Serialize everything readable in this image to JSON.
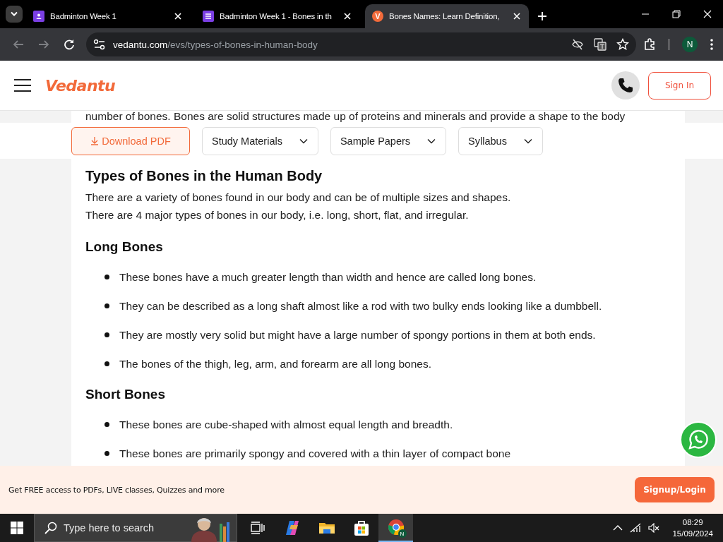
{
  "browser": {
    "tabs": [
      {
        "title": "Badminton Week 1",
        "kind": "form",
        "selected": false
      },
      {
        "title": "Badminton Week 1 - Bones in th",
        "kind": "list",
        "selected": false
      },
      {
        "title": "Bones Names: Learn Definition,",
        "kind": "site",
        "favicon_letter": "V",
        "selected": true
      }
    ],
    "nav": [
      {
        "kind": "back",
        "disabled": true
      },
      {
        "kind": "forward",
        "disabled": true
      },
      {
        "kind": "reload",
        "disabled": false
      }
    ],
    "url_host": "vedantu.com",
    "url_path": "/evs/types-of-bones-in-human-body",
    "profile_initial": "N"
  },
  "site_header": {
    "logo": "Vedantu",
    "sign_in": "Sign In"
  },
  "cut_top_line": "number of bones. Bones are solid structures made up of proteins and minerals and provide a shape to the body",
  "filter_bar": {
    "download": "Download PDF",
    "dropdowns": [
      "Study Materials",
      "Sample Papers",
      "Syllabus"
    ]
  },
  "article": [
    {
      "kind": "heading",
      "text": "Types of Bones in the Human Body"
    },
    {
      "kind": "paragraph",
      "lines": [
        "There are a  variety of bones found in our body and can be of multiple sizes and shapes.",
        "There are 4 major types of bones in our body, i.e. long, short, flat, and irregular."
      ]
    },
    {
      "kind": "subheading",
      "text": "Long Bones"
    },
    {
      "kind": "bullets",
      "items": [
        "These bones have a much greater length than width and hence are called long bones.",
        "They can be described as a  long shaft almost like a rod with two bulky ends looking like a dumbbell.",
        "They are mostly very solid but might have a large number of spongy portions in them at both ends.",
        "The bones of the thigh, leg, arm, and forearm are all long bones."
      ]
    },
    {
      "kind": "subheading",
      "text": "Short Bones"
    },
    {
      "kind": "bullets",
      "items": [
        "These bones are cube-shaped with almost equal length and breadth.",
        "These bones are primarily spongy and covered with a thin layer of compact bone"
      ]
    }
  ],
  "promo_banner": {
    "text": "Get FREE access to PDFs, LIVE classes, Quizzes and more",
    "button": "Signup/Login"
  },
  "taskbar": {
    "search_placeholder": "Type here to search",
    "apps": [
      {
        "kind": "taskview",
        "selected": false
      },
      {
        "kind": "copilot",
        "selected": false
      },
      {
        "kind": "explorer",
        "selected": false
      },
      {
        "kind": "store",
        "selected": false
      },
      {
        "kind": "chrome",
        "selected": true,
        "badge": "N"
      }
    ],
    "time": "08:29",
    "date": "15/09/2024"
  }
}
